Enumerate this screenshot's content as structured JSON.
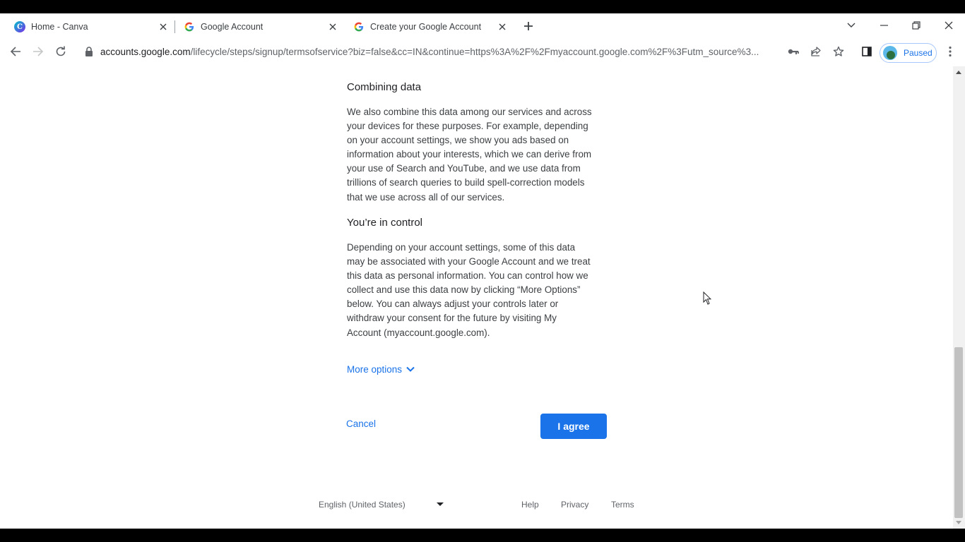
{
  "browser": {
    "tabs": [
      {
        "title": "Home - Canva",
        "icon": "canva-icon",
        "active": false
      },
      {
        "title": "Google Account",
        "icon": "google-icon",
        "active": false
      },
      {
        "title": "Create your Google Account",
        "icon": "google-icon",
        "active": true
      }
    ],
    "address": {
      "host": "accounts.google.com",
      "path": "/lifecycle/steps/signup/termsofservice?biz=false&cc=IN&continue=https%3A%2F%2Fmyaccount.google.com%2F%3Futm_source%3..."
    },
    "profile_label": "Paused"
  },
  "page": {
    "section1": {
      "heading": "Combining data",
      "lines": [
        "We also combine this data among our services and across",
        "your devices for these purposes. For example, depending",
        "on your account settings, we show you ads based on",
        "information about your interests, which we can derive from",
        "your use of Search and YouTube, and we use data from",
        "trillions of search queries to build spell-correction models",
        "that we use across all of our services."
      ]
    },
    "section2": {
      "heading": "You’re in control",
      "lines": [
        "Depending on your account settings, some of this data",
        "may be associated with your Google Account and we treat",
        "this data as personal information. You can control how we",
        "collect and use this data now by clicking “More Options”",
        "below. You can always adjust your controls later or",
        "withdraw your consent for the future by visiting My",
        "Account (myaccount.google.com)."
      ]
    },
    "more_options": "More options",
    "cancel": "Cancel",
    "agree": "I agree"
  },
  "footer": {
    "language": "English (United States)",
    "links": [
      "Help",
      "Privacy",
      "Terms"
    ]
  },
  "colors": {
    "accent": "#1a73e8",
    "text": "#3c4043"
  }
}
